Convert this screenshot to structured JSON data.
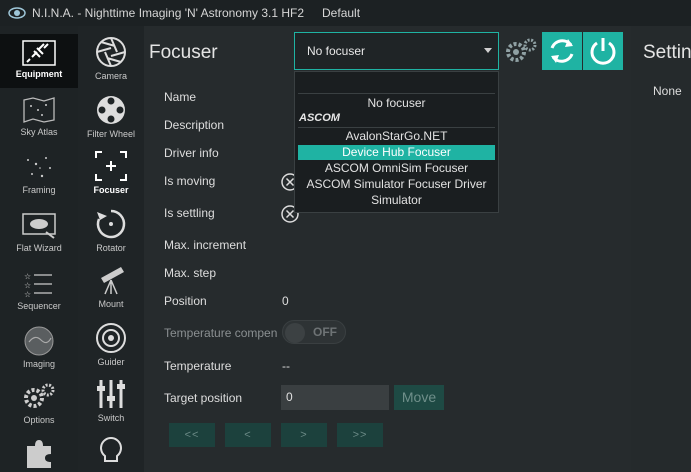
{
  "window": {
    "title": "N.I.N.A. - Nighttime Imaging 'N' Astronomy 3.1 HF2",
    "profile": "Default"
  },
  "nav_primary": [
    {
      "label": "Equipment",
      "icon": "plug-icon",
      "active": true
    },
    {
      "label": "Sky Atlas",
      "icon": "map-icon"
    },
    {
      "label": "Framing",
      "icon": "stars-icon"
    },
    {
      "label": "Flat Wizard",
      "icon": "flat-panel-icon"
    },
    {
      "label": "Sequencer",
      "icon": "sequence-icon"
    },
    {
      "label": "Imaging",
      "icon": "nebula-icon"
    },
    {
      "label": "Options",
      "icon": "gears-icon"
    },
    {
      "label": "",
      "icon": "puzzle-icon"
    }
  ],
  "nav_secondary": [
    {
      "label": "Camera",
      "icon": "aperture-icon"
    },
    {
      "label": "Filter Wheel",
      "icon": "filter-wheel-icon"
    },
    {
      "label": "Focuser",
      "icon": "focus-icon",
      "active": true
    },
    {
      "label": "Rotator",
      "icon": "rotator-icon"
    },
    {
      "label": "Mount",
      "icon": "telescope-icon"
    },
    {
      "label": "Guider",
      "icon": "target-icon"
    },
    {
      "label": "Switch",
      "icon": "sliders-icon"
    },
    {
      "label": "",
      "icon": "lightbulb-icon"
    }
  ],
  "focuser": {
    "heading": "Focuser",
    "selected_device": "No focuser",
    "dropdown": {
      "none_option": "No focuser",
      "group": "ASCOM",
      "options": [
        "AvalonStarGo.NET",
        "Device Hub Focuser",
        "ASCOM OmniSim Focuser",
        "ASCOM Simulator Focuser Driver",
        "Simulator"
      ],
      "highlighted": "Device Hub Focuser"
    },
    "properties": {
      "name": "Name",
      "description": "Description",
      "driver_info": "Driver info",
      "is_moving": "Is moving",
      "is_settling": "Is settling",
      "max_increment": "Max. increment",
      "max_step": "Max. step",
      "position": "Position",
      "position_value": "0",
      "temp_comp": "Temperature compen",
      "temp_comp_state": "OFF",
      "temperature": "Temperature",
      "temperature_value": "--",
      "target_position": "Target position",
      "target_value": "0"
    },
    "move_label": "Move",
    "step_buttons": [
      "<<",
      "<",
      ">",
      ">>"
    ]
  },
  "settings_panel": {
    "heading": "Setting",
    "value": "None"
  },
  "colors": {
    "accent": "#1fb3a3",
    "background": "#252a2c",
    "sidebar": "#1e2325"
  }
}
